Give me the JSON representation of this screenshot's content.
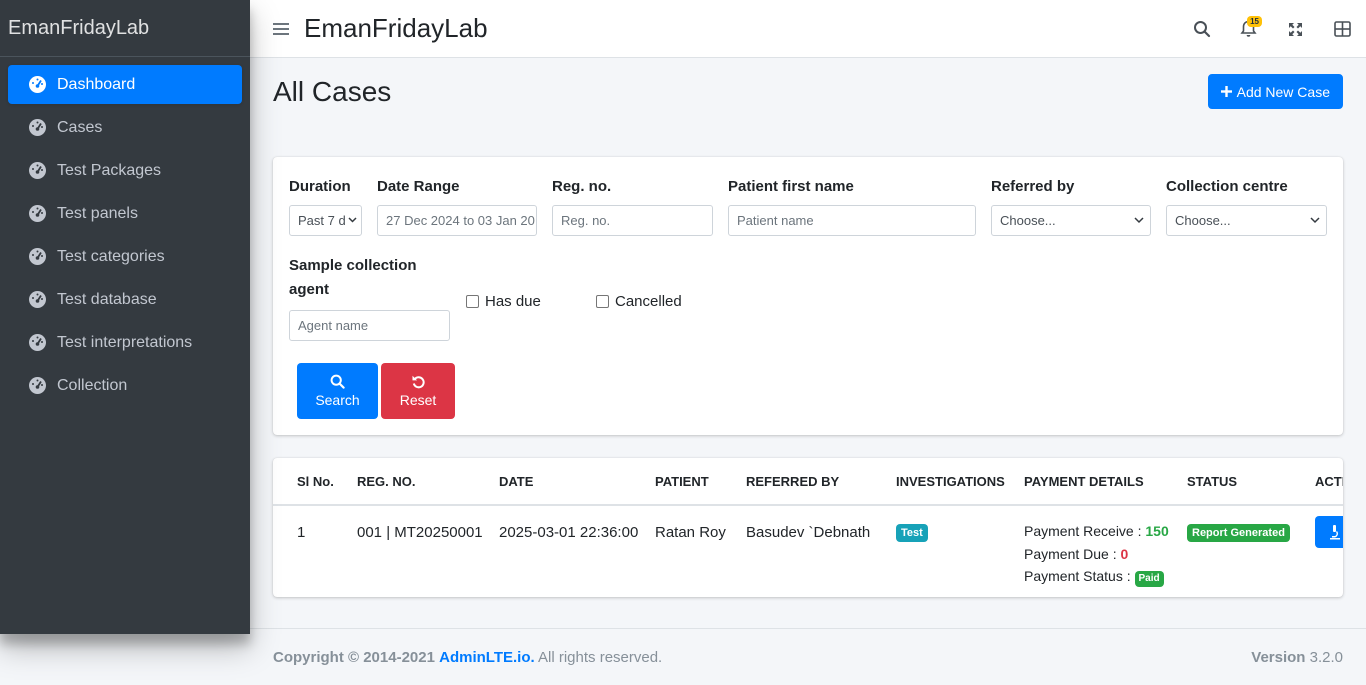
{
  "sidebar": {
    "brand": "EmanFridayLab",
    "items": [
      {
        "label": "Dashboard",
        "icon": "tachometer-icon",
        "active": true
      },
      {
        "label": "Cases",
        "icon": "tachometer-icon"
      },
      {
        "label": "Test Packages",
        "icon": "tachometer-icon"
      },
      {
        "label": "Test panels",
        "icon": "tachometer-icon"
      },
      {
        "label": "Test categories",
        "icon": "tachometer-icon"
      },
      {
        "label": "Test database",
        "icon": "tachometer-icon"
      },
      {
        "label": "Test interpretations",
        "icon": "tachometer-icon"
      },
      {
        "label": "Collection",
        "icon": "tachometer-icon"
      }
    ]
  },
  "topbar": {
    "title": "EmanFridayLab",
    "notifications_count": "15"
  },
  "page": {
    "title": "All Cases",
    "add_button": "Add New Case"
  },
  "filters": {
    "duration_label": "Duration",
    "duration_value": "Past 7 d",
    "date_range_label": "Date Range",
    "date_range_value": "27 Dec 2024 to 03 Jan 20",
    "reg_label": "Reg. no.",
    "reg_placeholder": "Reg. no.",
    "patient_label": "Patient first name",
    "patient_placeholder": "Patient name",
    "referred_label": "Referred by",
    "referred_value": "Choose...",
    "centre_label": "Collection centre",
    "centre_value": "Choose...",
    "agent_label_1": "Sample collection",
    "agent_label_2": "agent",
    "agent_placeholder": "Agent name",
    "has_due_label": "Has due",
    "cancelled_label": "Cancelled",
    "search_label": "Search",
    "reset_label": "Reset"
  },
  "table": {
    "headers": [
      "Sl No.",
      "REG. NO.",
      "DATE",
      "PATIENT",
      "REFERRED BY",
      "INVESTIGATIONS",
      "PAYMENT DETAILS",
      "STATUS",
      "ACTI"
    ],
    "rows": [
      {
        "sl": "1",
        "reg": "001 | MT20250001",
        "date": "2025-03-01 22:36:00",
        "patient": "Ratan Roy",
        "referred_by": "Basudev `Debnath",
        "investigation": "Test",
        "payment_receive_label": "Payment Receive :",
        "payment_receive": "150",
        "payment_due_label": "Payment Due :",
        "payment_due": "0",
        "payment_status_label": "Payment Status :",
        "payment_status": "Paid",
        "status": "Report Generated"
      }
    ]
  },
  "footer": {
    "copyright": "Copyright © 2014-2021",
    "link": "AdminLTE.io.",
    "rights": " All rights reserved.",
    "version_label": "Version",
    "version": " 3.2.0"
  },
  "colors": {
    "primary": "#007bff",
    "danger": "#dc3545",
    "success": "#28a745",
    "info": "#17a2b8",
    "warning": "#ffc107",
    "sidebar": "#343a40"
  }
}
